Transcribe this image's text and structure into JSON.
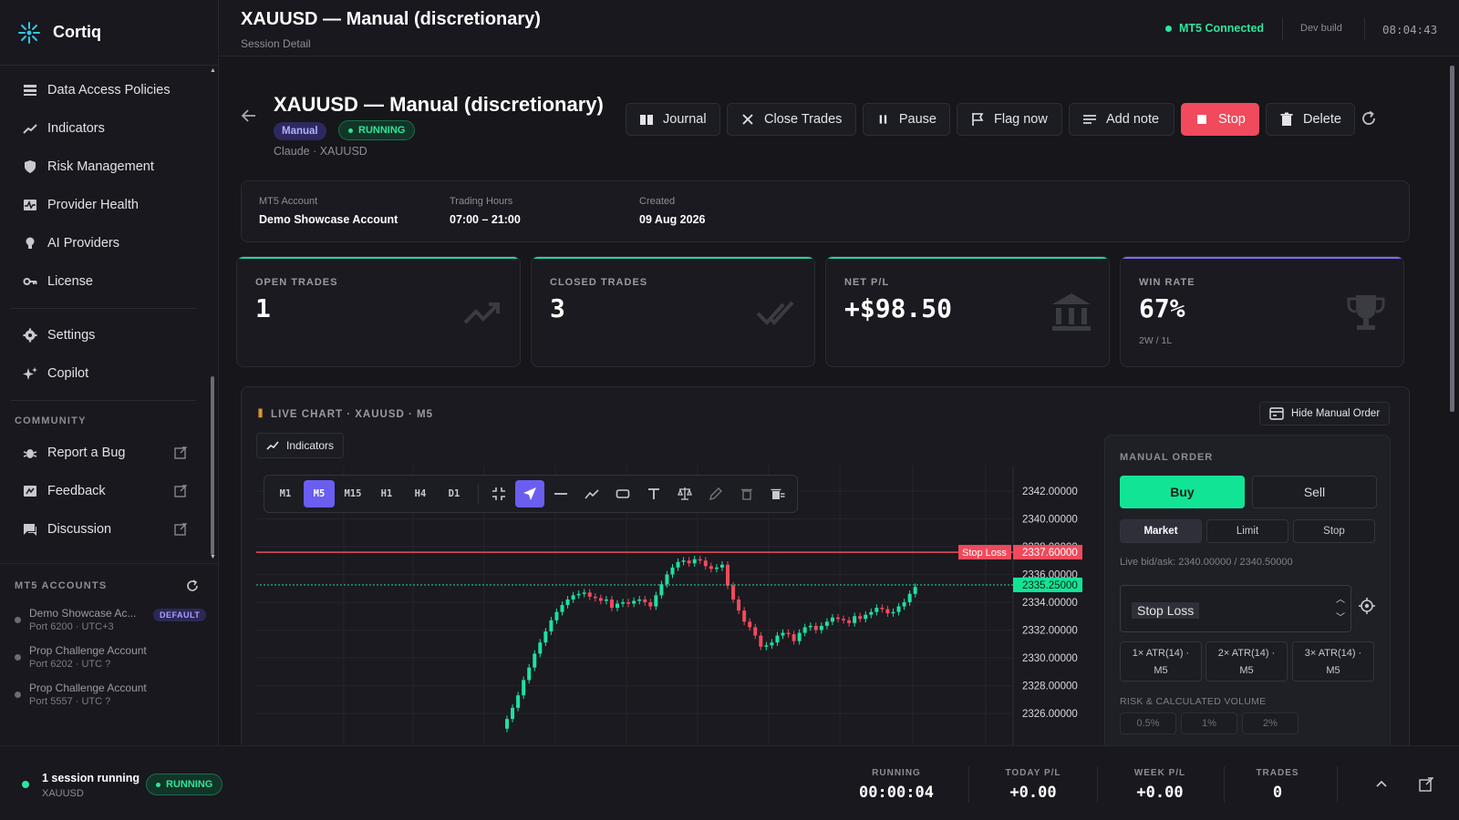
{
  "brand": {
    "name": "Cortiq"
  },
  "sidebar": {
    "items": [
      {
        "label": "Data Access Policies",
        "icon": "list-icon"
      },
      {
        "label": "Indicators",
        "icon": "trend-icon"
      },
      {
        "label": "Risk Management",
        "icon": "shield-icon"
      },
      {
        "label": "Provider Health",
        "icon": "pulse-icon"
      },
      {
        "label": "AI Providers",
        "icon": "brain-icon"
      },
      {
        "label": "License",
        "icon": "key-icon"
      }
    ],
    "items2": [
      {
        "label": "Settings",
        "icon": "gear-icon"
      },
      {
        "label": "Copilot",
        "icon": "sparkle-icon"
      }
    ],
    "community_label": "COMMUNITY",
    "community": [
      {
        "label": "Report a Bug",
        "icon": "bug-icon"
      },
      {
        "label": "Feedback",
        "icon": "feedback-icon"
      },
      {
        "label": "Discussion",
        "icon": "chat-icon"
      }
    ],
    "mt5_label": "MT5 ACCOUNTS",
    "accounts": [
      {
        "name": "Demo Showcase Ac...",
        "port": "Port 6200 · UTC+3",
        "badge": "DEFAULT"
      },
      {
        "name": "Prop Challenge Account",
        "port": "Port 6202 · UTC ?"
      },
      {
        "name": "Prop Challenge Account",
        "port": "Port 5557 · UTC ?"
      }
    ]
  },
  "header": {
    "title": "XAUUSD — Manual (discretionary)",
    "subtitle": "Session Detail",
    "mt5_status": "MT5 Connected",
    "build": "Dev build",
    "clock": "08:04:43"
  },
  "page": {
    "title": "XAUUSD — Manual (discretionary)",
    "tag_manual": "Manual",
    "tag_running": "RUNNING",
    "subtitle": "Claude · XAUUSD",
    "actions": {
      "journal": "Journal",
      "close_trades": "Close Trades",
      "pause": "Pause",
      "flag": "Flag now",
      "note": "Add note",
      "stop": "Stop",
      "delete": "Delete"
    }
  },
  "info": {
    "account_label": "MT5 Account",
    "account_value": "Demo Showcase Account",
    "hours_label": "Trading Hours",
    "hours_value": "07:00 – 21:00",
    "created_label": "Created",
    "created_value": "09 Aug 2026"
  },
  "stats": [
    {
      "label": "OPEN TRADES",
      "value": "1",
      "sub": "",
      "accent": "#1fd6a5"
    },
    {
      "label": "CLOSED TRADES",
      "value": "3",
      "sub": "",
      "accent": "#1fd6a5"
    },
    {
      "label": "NET P/L",
      "value": "+$98.50",
      "sub": "",
      "accent": "#1fd6a5"
    },
    {
      "label": "WIN RATE",
      "value": "67%",
      "sub": "2W / 1L",
      "accent": "#7d6cf2"
    }
  ],
  "chart": {
    "title": "LIVE CHART · XAUUSD · M5",
    "indicators_label": "Indicators",
    "hide_order_label": "Hide Manual Order",
    "timeframes": [
      "M1",
      "M5",
      "M15",
      "H1",
      "H4",
      "D1"
    ],
    "active_timeframe": "M5",
    "stop_loss_label": "Stop Loss",
    "stop_loss_price": "2337.60000",
    "current_price": "2335.25000",
    "price_ticks": [
      "2342.00000",
      "2340.00000",
      "2338.00000",
      "2336.00000",
      "2334.00000",
      "2332.00000",
      "2330.00000",
      "2328.00000",
      "2326.00000"
    ]
  },
  "chart_data": {
    "type": "candlestick",
    "y_axis_ticks": [
      2342,
      2340,
      2338,
      2336,
      2334,
      2332,
      2330,
      2328,
      2326
    ],
    "ylim": [
      2325,
      2343
    ],
    "stop_loss": 2337.6,
    "current_price": 2335.25,
    "closes": [
      2325.6,
      2326.4,
      2327.3,
      2328.4,
      2329.3,
      2330.3,
      2331.1,
      2331.9,
      2332.7,
      2333.3,
      2333.8,
      2334.2,
      2334.5,
      2334.6,
      2334.7,
      2334.4,
      2334.3,
      2334.1,
      2334.2,
      2333.6,
      2333.9,
      2334.0,
      2333.9,
      2334.1,
      2334.2,
      2334.0,
      2333.7,
      2334.5,
      2335.3,
      2336.0,
      2336.5,
      2336.9,
      2337.0,
      2336.8,
      2337.1,
      2337.0,
      2336.6,
      2336.4,
      2336.5,
      2336.7,
      2335.2,
      2334.2,
      2333.4,
      2332.6,
      2332.2,
      2331.6,
      2330.8,
      2330.9,
      2331.1,
      2331.6,
      2331.8,
      2331.7,
      2331.2,
      2331.8,
      2332.2,
      2332.3,
      2332.0,
      2332.3,
      2332.6,
      2332.9,
      2332.8,
      2332.7,
      2332.5,
      2333.0,
      2332.8,
      2333.1,
      2333.3,
      2333.6,
      2333.5,
      2333.2,
      2333.3,
      2333.7,
      2334.0,
      2334.6,
      2335.1
    ]
  },
  "order": {
    "title": "MANUAL ORDER",
    "buy": "Buy",
    "sell": "Sell",
    "types": [
      "Market",
      "Limit",
      "Stop"
    ],
    "bidask": "Live bid/ask: 2340.00000 / 2340.50000",
    "sl_label": "Stop Loss",
    "atr": [
      {
        "l1": "1× ATR(14) ·",
        "l2": "M5"
      },
      {
        "l1": "2× ATR(14) ·",
        "l2": "M5"
      },
      {
        "l1": "3× ATR(14) ·",
        "l2": "M5"
      }
    ],
    "risk_label": "RISK & CALCULATED VOLUME",
    "risk_options": [
      "0.5%",
      "1%",
      "2%"
    ]
  },
  "bottom": {
    "title": "1 session running",
    "sub": "XAUUSD",
    "badge": "RUNNING",
    "running_label": "RUNNING",
    "running_value": "00:00:04",
    "today_label": "TODAY P/L",
    "today_value": "+0.00",
    "week_label": "WEEK P/L",
    "week_value": "+0.00",
    "trades_label": "TRADES",
    "trades_value": "0"
  },
  "colors": {
    "accent": "#6a5ef0",
    "up": "#1fe0a0",
    "down": "#f24a5c",
    "stop": "#f04a5c"
  }
}
